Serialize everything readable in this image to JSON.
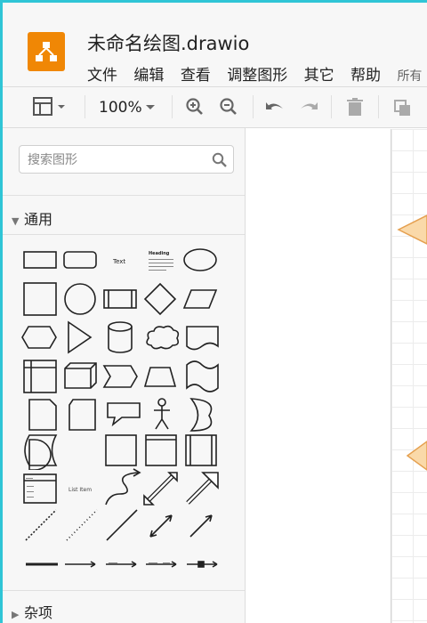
{
  "app": {
    "title": "未命名绘图.drawio",
    "accent": "#2fc5d6",
    "logo_color": "#f08705"
  },
  "menu": {
    "items": [
      "文件",
      "编辑",
      "查看",
      "调整图形",
      "其它",
      "帮助"
    ],
    "status": "所有"
  },
  "toolbar": {
    "zoom": "100%",
    "buttons": [
      "format-panel-icon",
      "zoom-in-icon",
      "zoom-out-icon",
      "undo-icon",
      "redo-icon",
      "delete-icon",
      "to-front-icon"
    ]
  },
  "sidebar": {
    "search_placeholder": "搜索图形",
    "sections": {
      "general": {
        "label": "通用",
        "expanded": true
      },
      "misc": {
        "label": "杂项",
        "expanded": false
      }
    },
    "shape_labels": {
      "text": "Text",
      "heading": "Heading",
      "list_item": "List Item"
    }
  },
  "canvas": {
    "shape_fill": "#fad9a9",
    "shape_stroke": "#e5a050"
  }
}
